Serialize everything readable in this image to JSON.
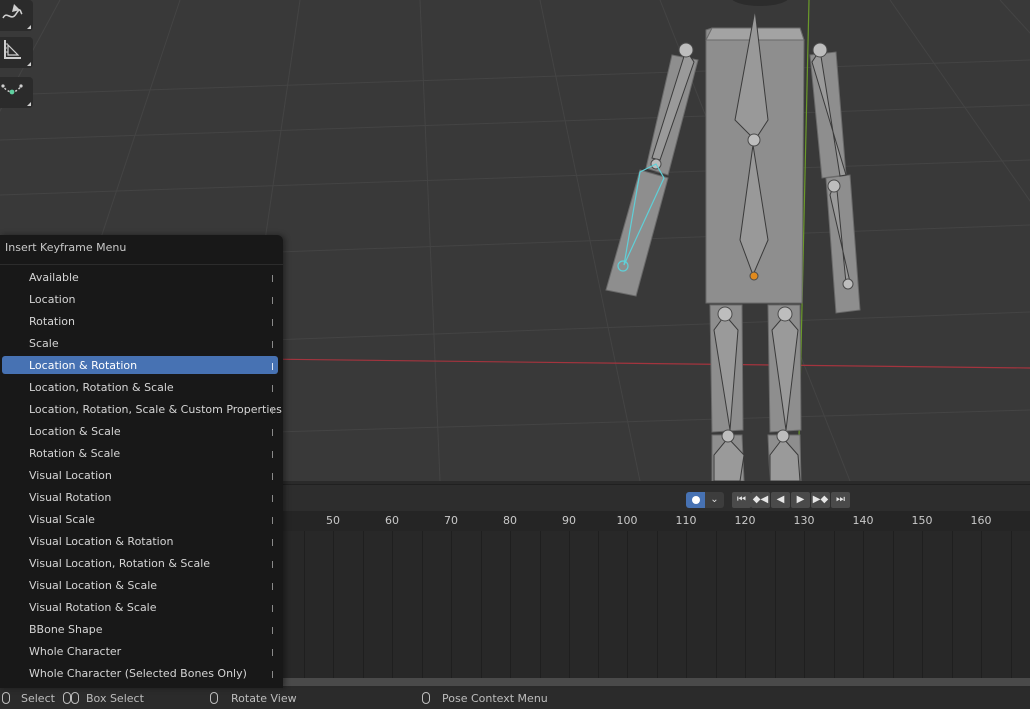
{
  "menu": {
    "title": "Insert Keyframe Menu",
    "active_index": 4,
    "items": [
      {
        "label": "Available"
      },
      {
        "label": "Location"
      },
      {
        "label": "Rotation"
      },
      {
        "label": "Scale"
      },
      {
        "label": "Location & Rotation"
      },
      {
        "label": "Location, Rotation & Scale"
      },
      {
        "label": "Location, Rotation, Scale & Custom Properties"
      },
      {
        "label": "Location & Scale"
      },
      {
        "label": "Rotation & Scale"
      },
      {
        "label": "Visual Location"
      },
      {
        "label": "Visual Rotation"
      },
      {
        "label": "Visual Scale"
      },
      {
        "label": "Visual Location & Rotation"
      },
      {
        "label": "Visual Location, Rotation & Scale"
      },
      {
        "label": "Visual Location & Scale"
      },
      {
        "label": "Visual Rotation & Scale"
      },
      {
        "label": "BBone Shape"
      },
      {
        "label": "Whole Character"
      },
      {
        "label": "Whole Character (Selected Bones Only)"
      }
    ]
  },
  "toolbar": {
    "tools": [
      "annotate-icon",
      "measure-icon",
      "bone-envelope-icon"
    ]
  },
  "timeline": {
    "frames": [
      "50",
      "60",
      "70",
      "80",
      "90",
      "100",
      "110",
      "120",
      "130",
      "140",
      "150",
      "160"
    ],
    "playback_icons": [
      "jump-start-icon",
      "prev-keyframe-icon",
      "play-reverse-icon",
      "play-icon",
      "next-keyframe-icon",
      "jump-end-icon"
    ],
    "playback_glyphs": [
      "⏮",
      "◆◀",
      "◀",
      "▶",
      "▶◆",
      "⏭"
    ]
  },
  "statusbar": {
    "select": "Select",
    "box_select": "Box Select",
    "rotate_view": "Rotate View",
    "context_menu": "Pose Context Menu"
  },
  "colors": {
    "accent": "#4772b3",
    "selected_bone": "#5fd0d8",
    "x_axis": "#a4343e",
    "y_axis": "#6b9a2a"
  }
}
